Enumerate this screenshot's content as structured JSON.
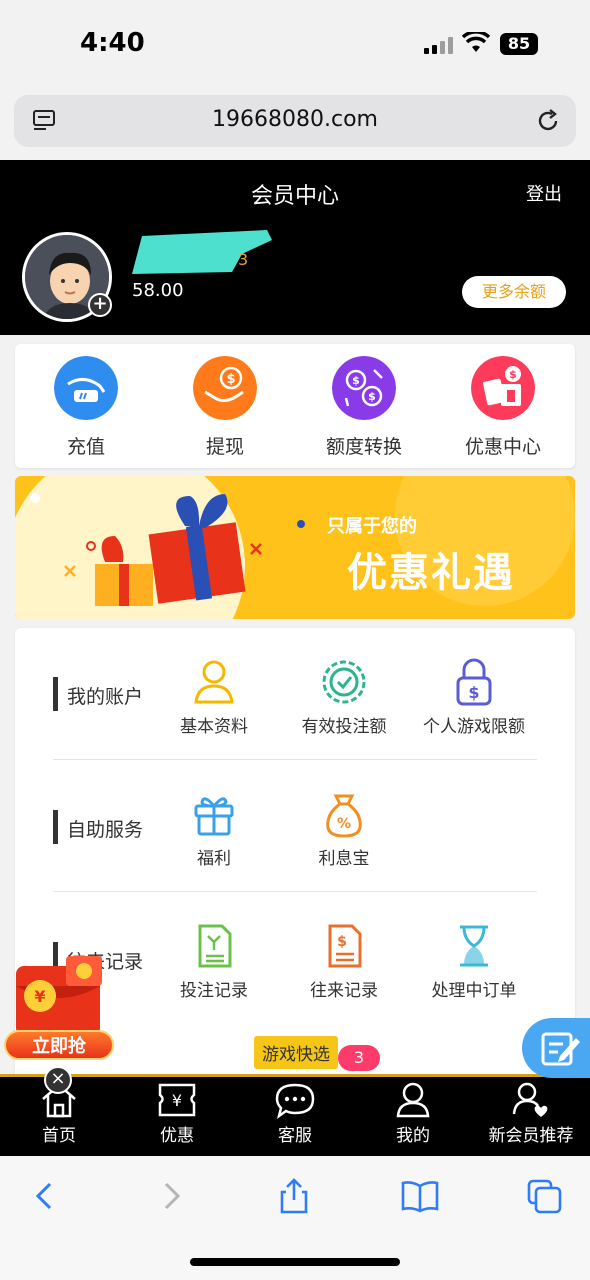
{
  "status_bar": {
    "time": "4:40",
    "battery": "85"
  },
  "browser": {
    "url": "19668080.com"
  },
  "header": {
    "title": "会员中心",
    "logout_label": "登出",
    "username_tail": "3",
    "balance": "58.00",
    "more_balance_label": "更多余额"
  },
  "quick_actions": [
    {
      "label": "充值",
      "icon": "deposit-icon",
      "color": "#2f8df0"
    },
    {
      "label": "提现",
      "icon": "withdraw-icon",
      "color": "#ff7a1a"
    },
    {
      "label": "额度转换",
      "icon": "transfer-icon",
      "color": "#8a3be8"
    },
    {
      "label": "优惠中心",
      "icon": "promo-center-icon",
      "color": "#ff3b5c"
    }
  ],
  "banner": {
    "subtitle": "只属于您的",
    "title": "优惠礼遇"
  },
  "sections": [
    {
      "title": "我的账户",
      "items": [
        {
          "label": "基本资料",
          "icon": "profile-icon"
        },
        {
          "label": "有效投注额",
          "icon": "valid-bet-icon"
        },
        {
          "label": "个人游戏限额",
          "icon": "game-limit-icon"
        }
      ]
    },
    {
      "title": "自助服务",
      "items": [
        {
          "label": "福利",
          "icon": "gift-icon"
        },
        {
          "label": "利息宝",
          "icon": "interest-bag-icon"
        }
      ]
    },
    {
      "title": "往来记录",
      "items": [
        {
          "label": "投注记录",
          "icon": "bet-record-icon"
        },
        {
          "label": "往来记录",
          "icon": "transaction-record-icon"
        },
        {
          "label": "处理中订单",
          "icon": "pending-order-icon"
        }
      ]
    }
  ],
  "game_shortcut": {
    "label": "游戏快选",
    "badge": "3"
  },
  "promo_float": {
    "label": "立即抢"
  },
  "bottom_nav": [
    {
      "label": "首页",
      "icon": "home-icon"
    },
    {
      "label": "优惠",
      "icon": "coupon-icon"
    },
    {
      "label": "客服",
      "icon": "chat-icon"
    },
    {
      "label": "我的",
      "icon": "user-icon"
    },
    {
      "label": "新会员推荐",
      "icon": "referral-icon"
    }
  ],
  "colors": {
    "accent": "#d4a017",
    "header_bg": "#000000",
    "banner_bg": "#ffc21a"
  }
}
